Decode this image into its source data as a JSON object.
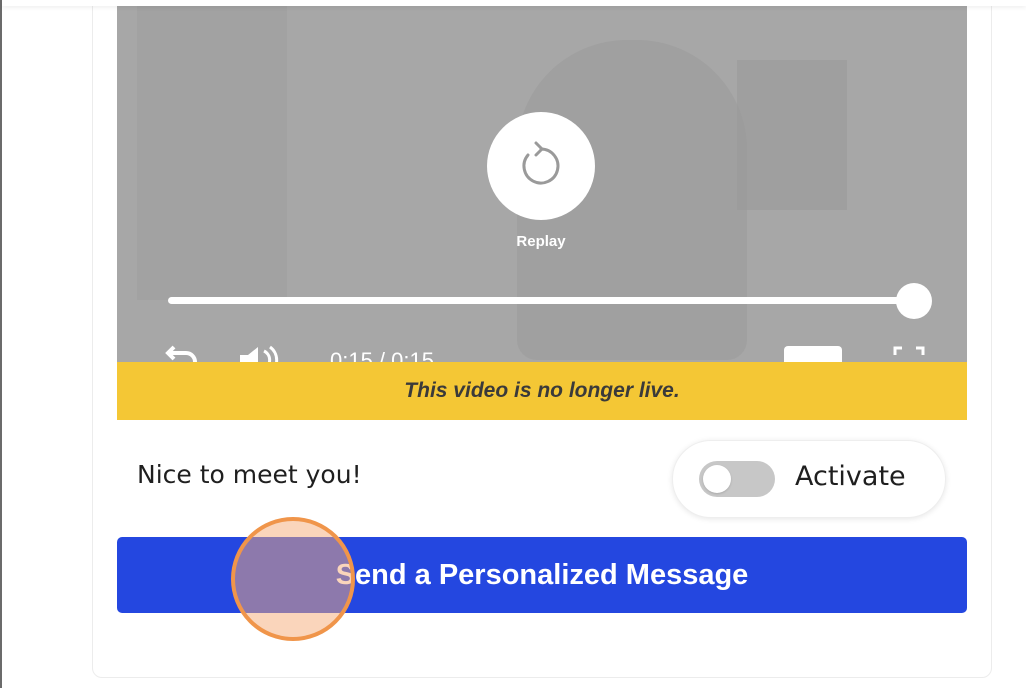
{
  "video": {
    "replay_label": "Replay",
    "time_display": "0:15 / 0:15",
    "progress": 1.0,
    "expired_banner": "This video is no longer live."
  },
  "message": {
    "greeting": "Nice to meet you!"
  },
  "activate": {
    "label": "Activate",
    "toggled_on": false
  },
  "cta": {
    "send_label": "Send a Personalized Message",
    "color": "#2447e0"
  },
  "colors": {
    "banner": "#f4c735",
    "overlay": "#a7a7a7",
    "click_indicator": "#f0954a"
  }
}
